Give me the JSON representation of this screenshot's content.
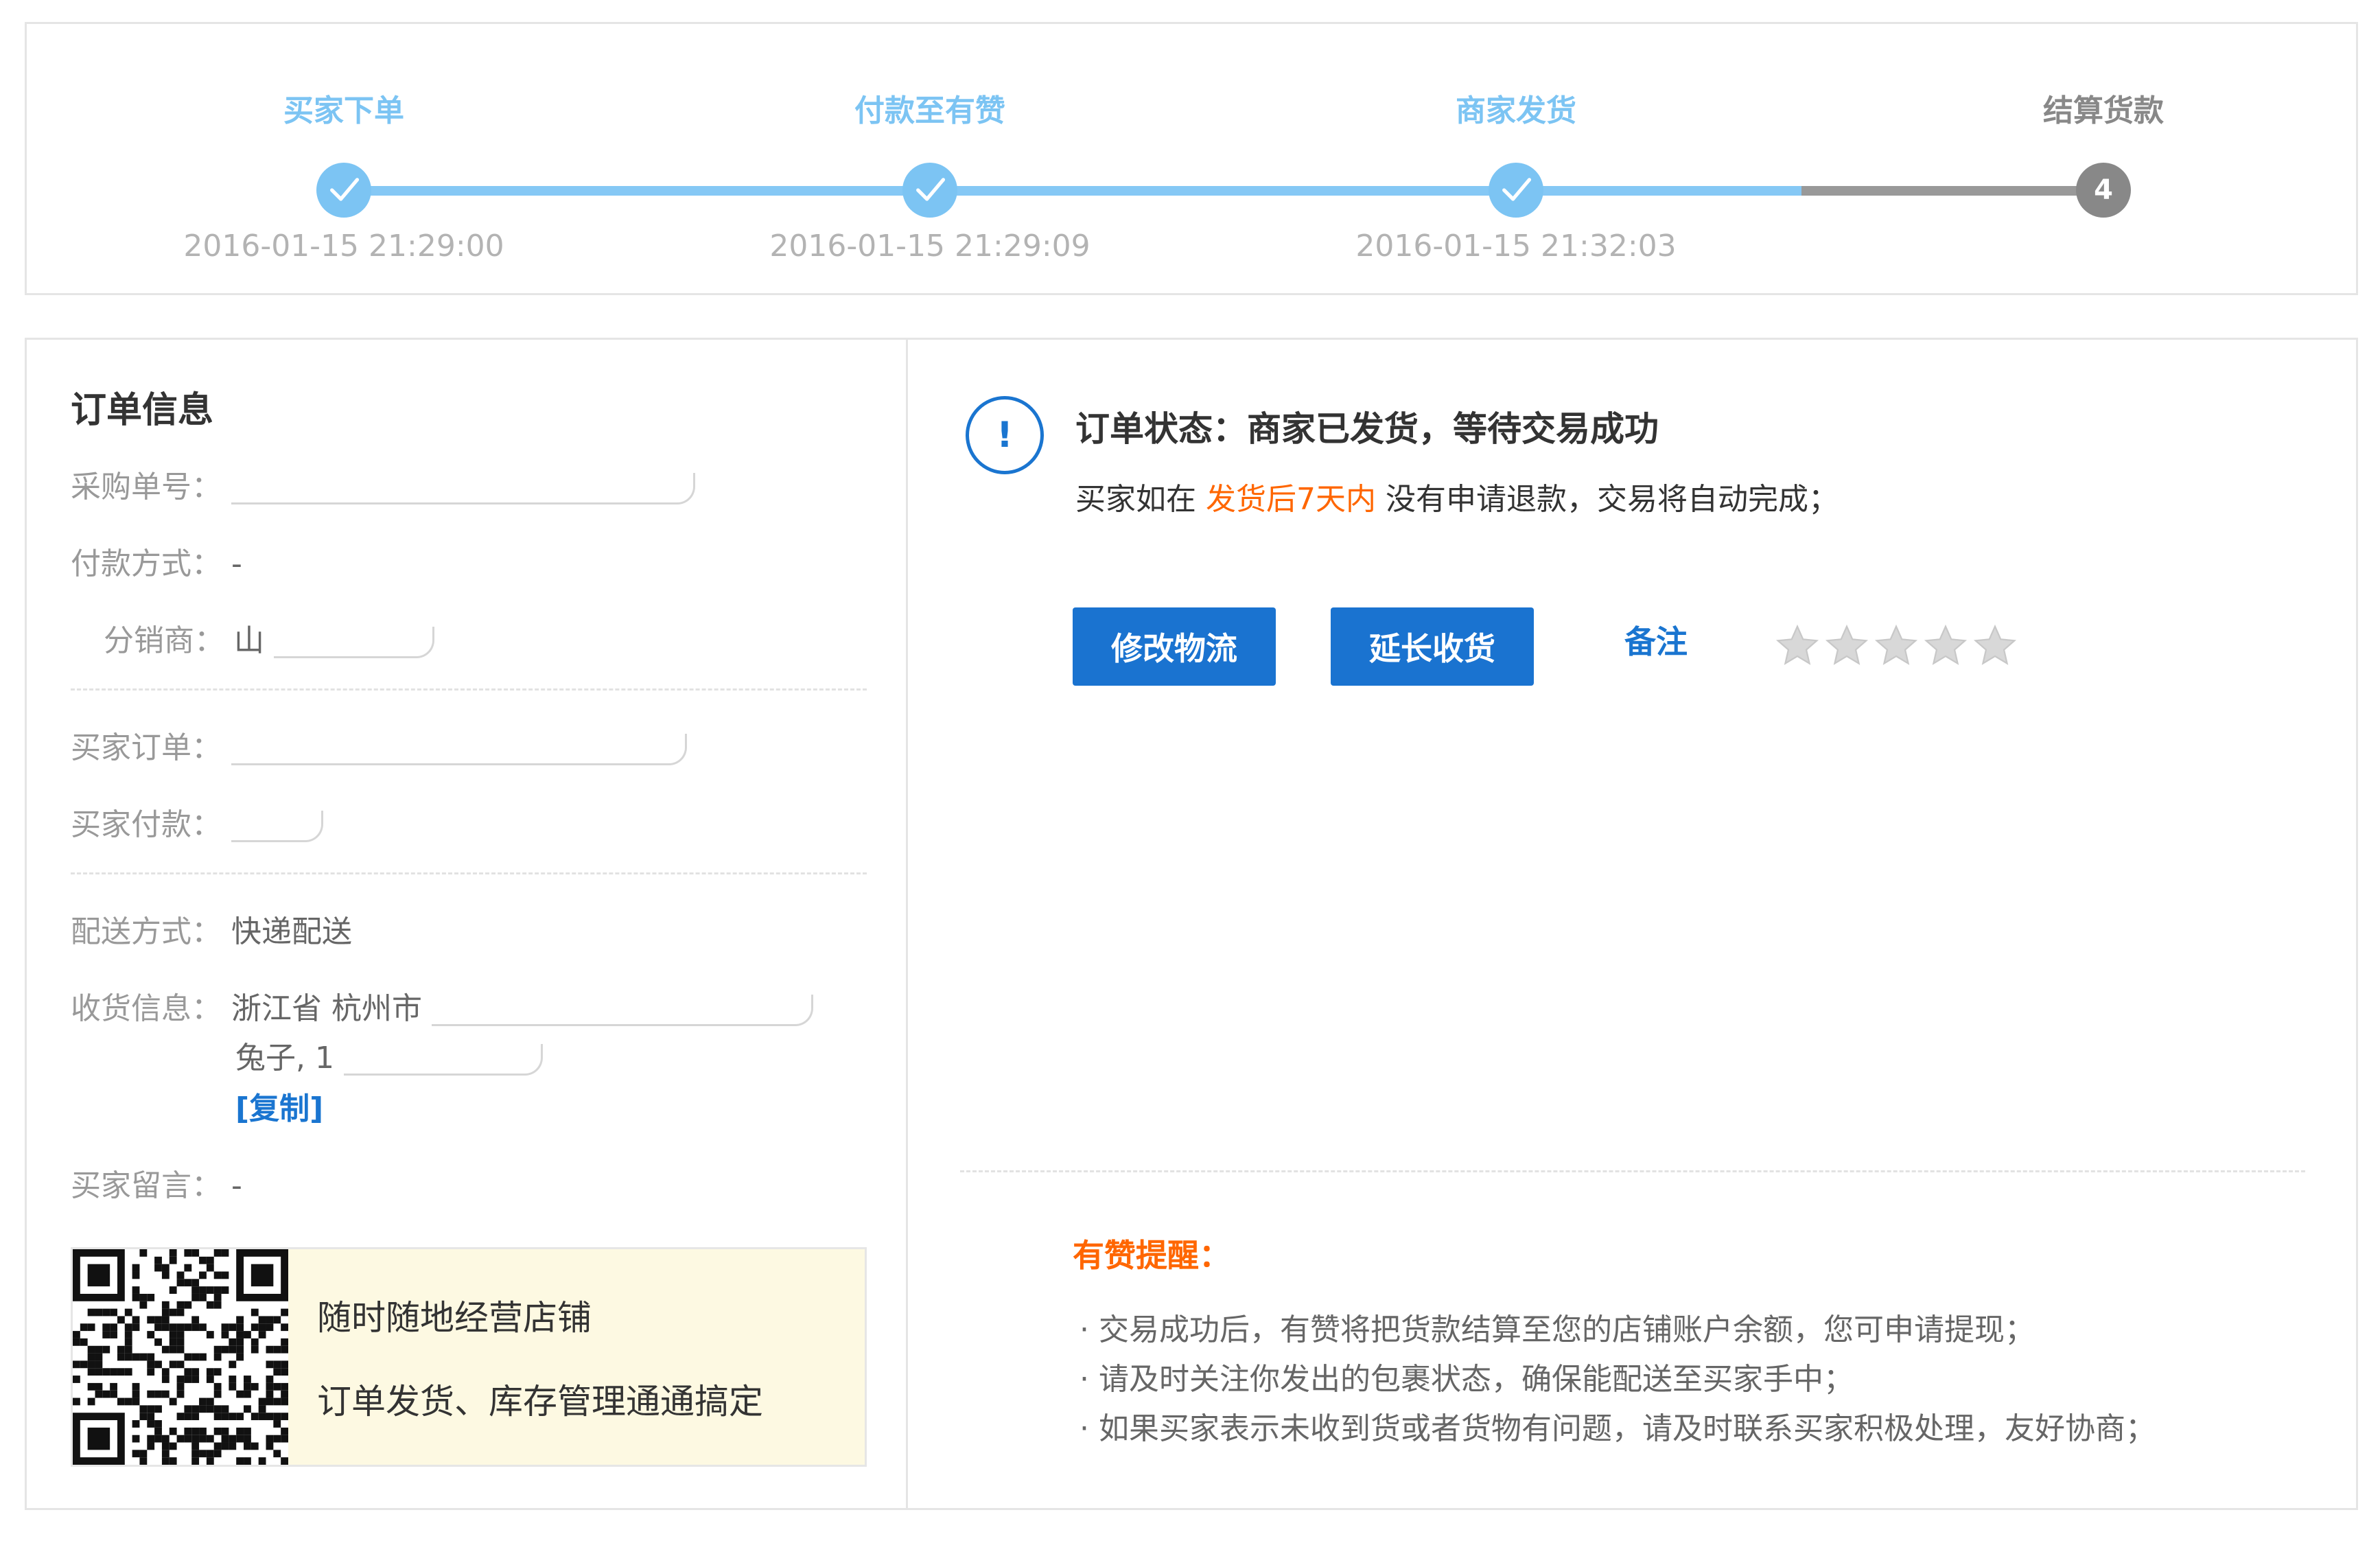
{
  "steps": [
    {
      "title": "买家下单",
      "time": "2016-01-15 21:29:00",
      "done": true
    },
    {
      "title": "付款至有赞",
      "time": "2016-01-15 21:29:09",
      "done": true
    },
    {
      "title": "商家发货",
      "time": "2016-01-15 21:32:03",
      "done": true
    },
    {
      "title": "结算货款",
      "time": "",
      "done": false,
      "number": "4"
    }
  ],
  "order_info": {
    "title": "订单信息",
    "purchase_no_label": "采购单号：",
    "payment_method_label": "付款方式：",
    "payment_method_value": "-",
    "distributor_label": "分销商：",
    "distributor_value": "山",
    "buyer_order_label": "买家订单：",
    "buyer_payment_label": "买家付款：",
    "delivery_label": "配送方式：",
    "delivery_value": "快递配送",
    "receiver_label": "收货信息：",
    "receiver_address": "浙江省 杭州市",
    "receiver_name": "兔子, 1",
    "copy_label": "[复制]",
    "message_label": "买家留言：",
    "message_value": "-"
  },
  "promo": {
    "line1": "随时随地经营店铺",
    "line2": "订单发货、库存管理通通搞定"
  },
  "status": {
    "title": "订单状态：商家已发货，等待交易成功",
    "desc_prefix": "买家如在",
    "desc_highlight": "发货后7天内",
    "desc_suffix": "没有申请退款，交易将自动完成；",
    "icon_text": "!"
  },
  "actions": {
    "modify_logistics": "修改物流",
    "extend_receipt": "延长收货",
    "note": "备注",
    "rating": 0,
    "rating_max": 5
  },
  "tips": {
    "title": "有赞提醒：",
    "items": [
      "· 交易成功后，有赞将把货款结算至您的店铺账户余额，您可申请提现；",
      "· 请及时关注你发出的包裹状态，确保能配送至买家手中；",
      "· 如果买家表示未收到货或者货物有问题，请及时联系买家积极处理，友好协商；"
    ]
  },
  "colors": {
    "accent_blue": "#1a75d0",
    "step_done": "#7cc4f3",
    "step_pending": "#888888",
    "highlight": "#ff6600",
    "promo_bg": "#fdf9e2"
  }
}
